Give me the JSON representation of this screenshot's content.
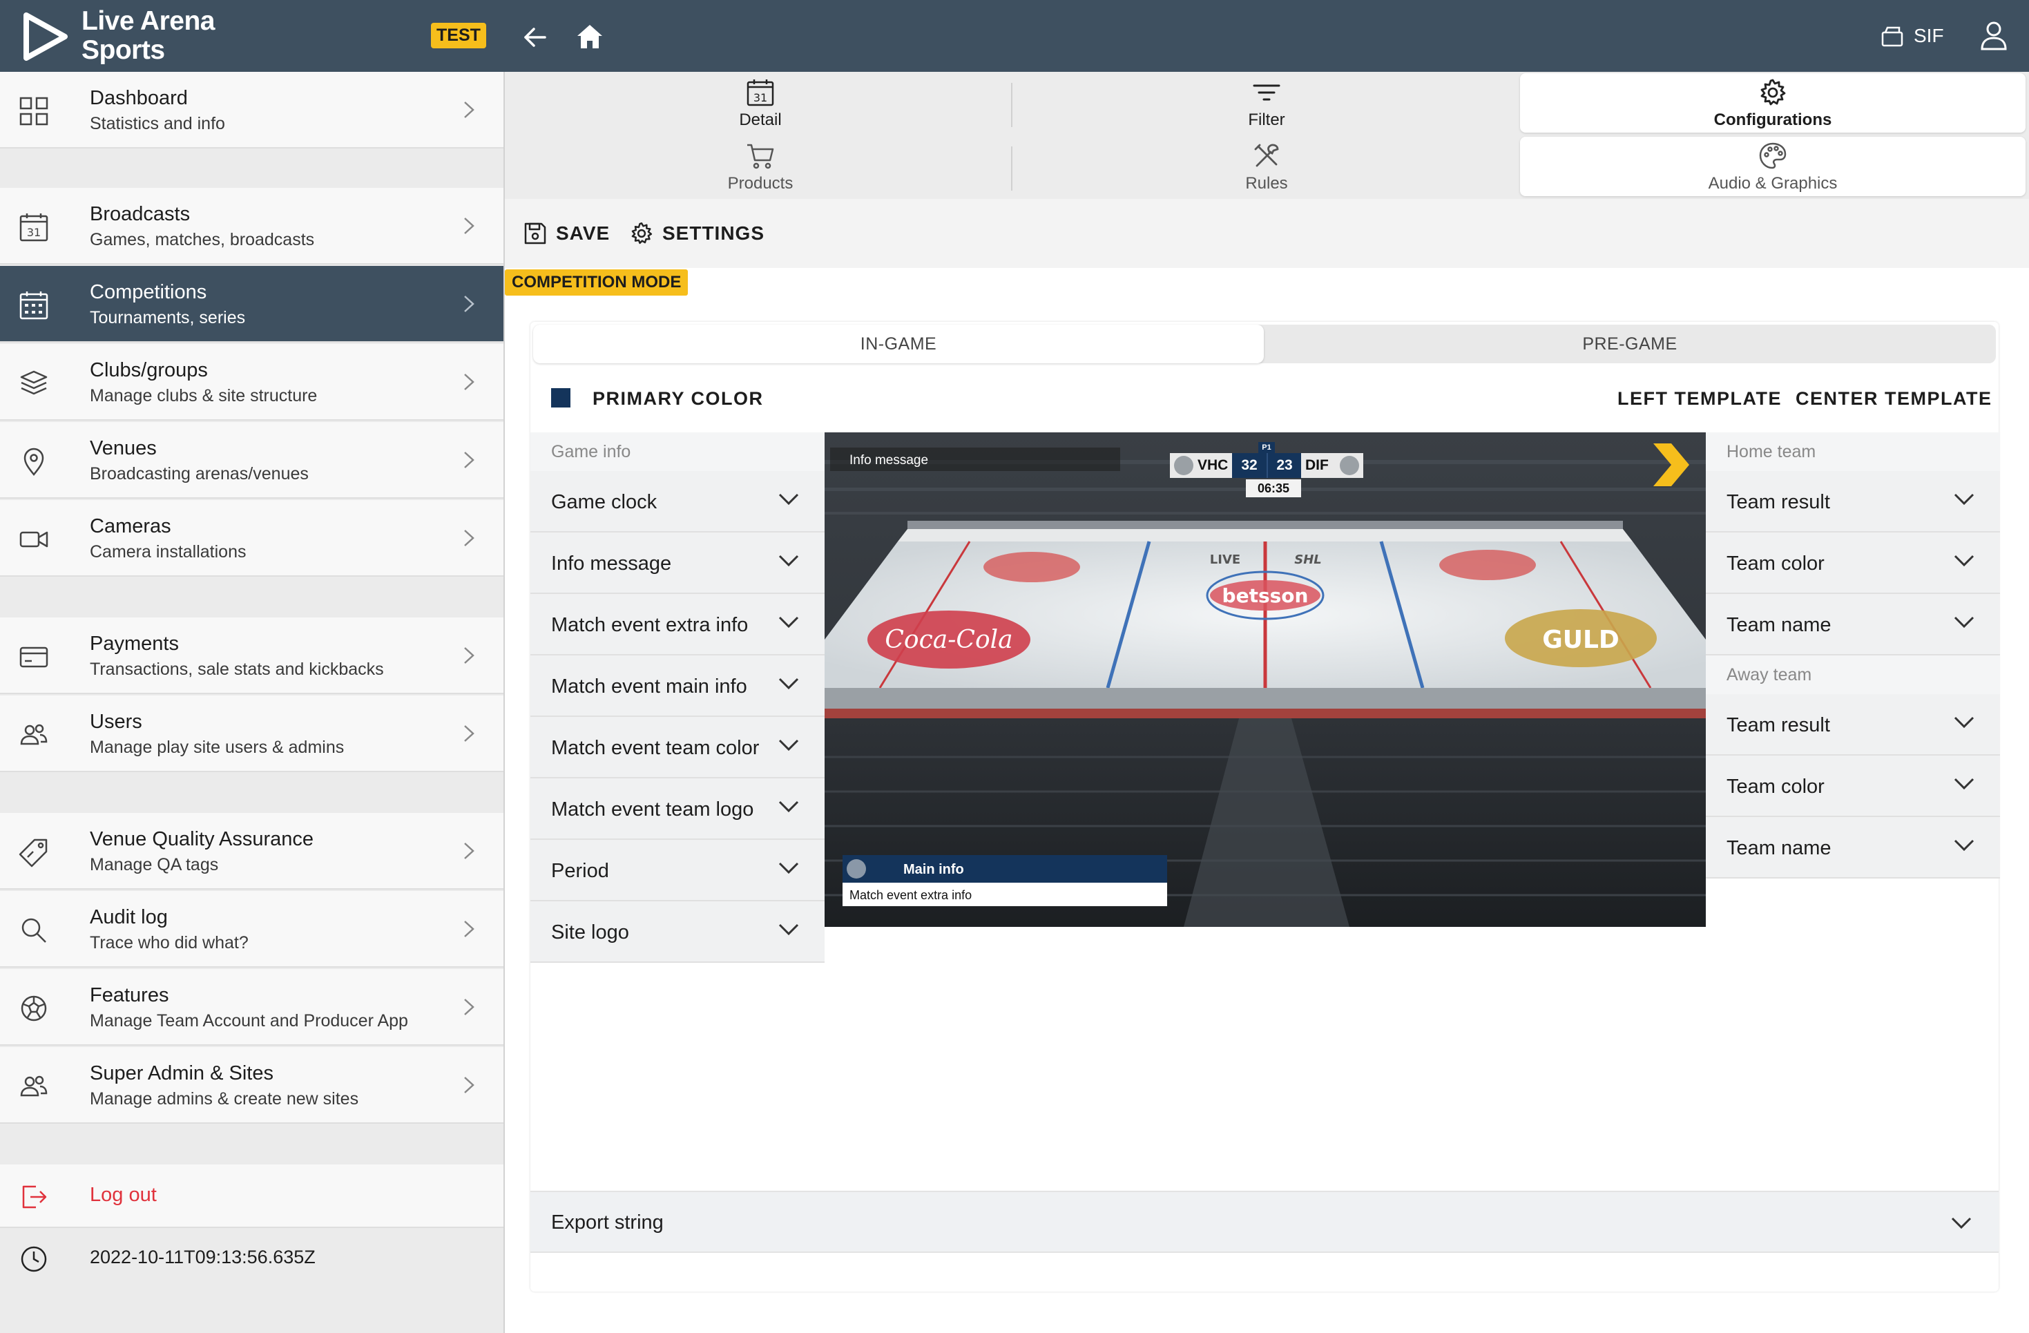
{
  "brand": {
    "name_line1": "Live Arena",
    "name_line2": "Sports",
    "badge": "TEST",
    "accent": "#f6be1c",
    "header_bg": "#3e5060"
  },
  "sidebar": {
    "items": [
      {
        "title": "Dashboard",
        "subtitle": "Statistics and info",
        "icon": "dashboard-grid-icon"
      },
      {
        "title": "Broadcasts",
        "subtitle": "Games, matches, broadcasts",
        "icon": "calendar-31-icon"
      },
      {
        "title": "Competitions",
        "subtitle": "Tournaments, series",
        "icon": "calendar-grid-icon",
        "active": true
      },
      {
        "title": "Clubs/groups",
        "subtitle": "Manage clubs & site structure",
        "icon": "layers-icon"
      },
      {
        "title": "Venues",
        "subtitle": "Broadcasting arenas/venues",
        "icon": "map-pin-icon"
      },
      {
        "title": "Cameras",
        "subtitle": "Camera installations",
        "icon": "video-camera-icon"
      },
      {
        "title": "Payments",
        "subtitle": "Transactions, sale stats and kickbacks",
        "icon": "credit-card-icon"
      },
      {
        "title": "Users",
        "subtitle": "Manage play site users & admins",
        "icon": "users-icon"
      },
      {
        "title": "Venue Quality Assurance",
        "subtitle": "Manage QA tags",
        "icon": "tag-icon"
      },
      {
        "title": "Audit log",
        "subtitle": "Trace who did what?",
        "icon": "search-icon"
      },
      {
        "title": "Features",
        "subtitle": "Manage Team Account and Producer App",
        "icon": "soccer-ball-icon"
      },
      {
        "title": "Super Admin & Sites",
        "subtitle": "Manage admins & create new sites",
        "icon": "admins-icon"
      }
    ],
    "logout": "Log out",
    "timestamp": "2022-10-11T09:13:56.635Z"
  },
  "topbar": {
    "site": "SIF"
  },
  "tabs": [
    {
      "label": "Detail",
      "icon": "calendar-31-icon"
    },
    {
      "label": "Filter",
      "icon": "filter-icon"
    },
    {
      "label": "Configurations",
      "icon": "gear-icon",
      "active": true
    },
    {
      "label": "Products",
      "icon": "cart-icon"
    },
    {
      "label": "Rules",
      "icon": "tools-icon"
    },
    {
      "label": "Audio & Graphics",
      "icon": "palette-icon",
      "active": true
    }
  ],
  "actions": {
    "save": "SAVE",
    "settings": "SETTINGS"
  },
  "mode_badge": "COMPETITION MODE",
  "segments": {
    "in_game": "IN-GAME",
    "pre_game": "PRE-GAME",
    "selected": "IN-GAME"
  },
  "panel": {
    "primary_color_label": "PRIMARY COLOR",
    "primary_color": "#14345b",
    "left_template": "LEFT TEMPLATE",
    "center_template": "CENTER TEMPLATE"
  },
  "game_info": {
    "group": "Game info",
    "items": [
      "Game clock",
      "Info message",
      "Match event extra info",
      "Match event main info",
      "Match event team color",
      "Match event team logo",
      "Period",
      "Site logo"
    ]
  },
  "home_team": {
    "group": "Home team",
    "items": [
      "Team result",
      "Team color",
      "Team name"
    ]
  },
  "away_team": {
    "group": "Away team",
    "items": [
      "Team result",
      "Team color",
      "Team name"
    ]
  },
  "preview": {
    "info_message": "Info message",
    "period": "P1",
    "home_abbr": "VHC",
    "home_score": "32",
    "away_score": "23",
    "away_abbr": "DIF",
    "clock": "06:35",
    "main_info": "Main info",
    "extra_info": "Match event extra info",
    "board_ads": [
      "betsson",
      "Coca-Cola",
      "GULD",
      "LIVE",
      "SHL"
    ]
  },
  "export": {
    "label": "Export string"
  }
}
